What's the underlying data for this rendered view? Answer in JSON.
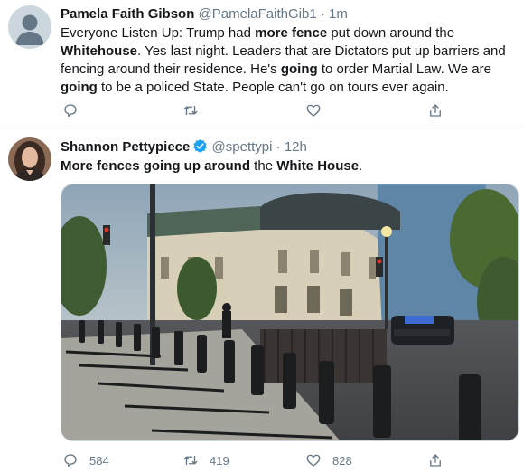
{
  "tweet1": {
    "name": "Pamela Faith Gibson",
    "handle": "@PamelaFaithGib1",
    "dot": "·",
    "time": "1m",
    "text": {
      "t1": "Everyone Listen Up:  Trump had ",
      "b1": "more fence",
      "t2": " put down around the ",
      "b2": "Whitehouse",
      "t3": ". Yes last night. Leaders that are Dictators put up barriers and fencing around their residence. He's ",
      "b3": "going",
      "t4": " to order Martial Law. We are ",
      "b4": "going",
      "t5": " to be a policed State. People can't go on tours ever again."
    },
    "icons": [
      "reply-icon",
      "retweet-icon",
      "like-icon",
      "share-icon"
    ]
  },
  "tweet2": {
    "name": "Shannon Pettypiece",
    "handle": "@spettypi",
    "dot": "·",
    "time": "12h",
    "text": {
      "b1": "More fences going up around",
      "t1": " the ",
      "b2": "White House",
      "t2": "."
    },
    "reply_count": "584",
    "retweet_count": "419",
    "like_count": "828",
    "icons": [
      "reply-icon",
      "retweet-icon",
      "like-icon",
      "share-icon"
    ]
  },
  "colors": {
    "text_primary": "#14171a",
    "text_secondary": "#657786",
    "divider": "#e6ecf0",
    "verified": "#1da1f2"
  }
}
